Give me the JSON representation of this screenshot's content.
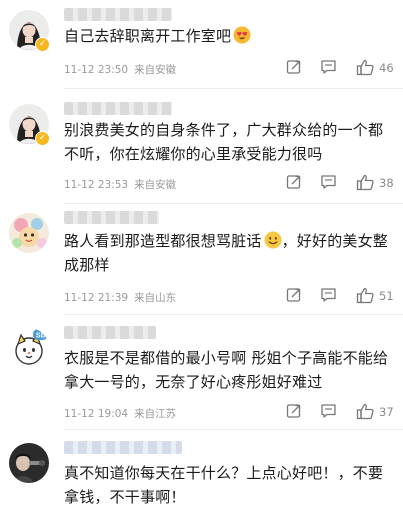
{
  "comments": [
    {
      "text": "自己去辞职离开工作室吧",
      "emoji": "heart-eyes-emoji",
      "time": "11-12 23:50",
      "location": "来自安徽",
      "likes": "46",
      "verified": true
    },
    {
      "text": "别浪费美女的自身条件了，广大群众给的一个都不听，你在炫耀你的心里承受能力很吗",
      "time": "11-12 23:53",
      "location": "来自安徽",
      "likes": "38",
      "verified": true
    },
    {
      "text_before": "路人看到那造型都很想骂脏话",
      "emoji": "smile-emoji",
      "text_after": "，好好的美女整成那样",
      "time": "11-12 21:39",
      "location": "来自山东",
      "likes": "51"
    },
    {
      "text": "衣服是不是都借的最小号啊 彤姐个子高能不能给拿大一号的，无奈了好心疼彤姐好难过",
      "time": "11-12 19:04",
      "location": "来自江苏",
      "likes": "37",
      "avatar_badge": "Sb"
    },
    {
      "text": "真不知道你每天在干什么？上点心好吧！，不要拿钱，不干事啊！"
    }
  ],
  "icons": {
    "share": "share-icon",
    "comment": "comment-icon",
    "like": "thumbs-up-icon",
    "verified": "verified-badge-icon"
  },
  "colors": {
    "meta_text": "#9a9a9a",
    "verified_badge": "#f7b81f"
  }
}
